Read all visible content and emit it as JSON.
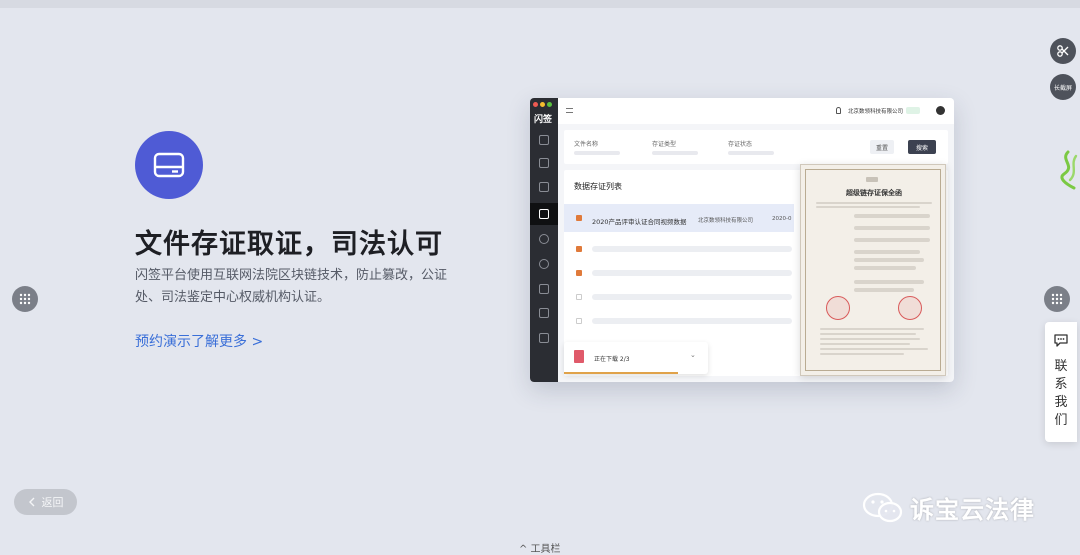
{
  "hero": {
    "title": "文件存证取证，司法认可",
    "description": "闪签平台使用互联网法院区块链技术，防止篡改，公证处、司法鉴定中心权威机构认证。",
    "link": "预约演示了解更多 >"
  },
  "app": {
    "logo": "闪签",
    "company": "北京数领科技有限公司",
    "filter_labels": [
      "文件名称",
      "存证类型",
      "存证状态"
    ],
    "reset_label": "重置",
    "search_label": "搜索",
    "list_title": "数据存证列表",
    "row_title": "2020产品评审认证合同视频数据",
    "row_company": "北京数领科技有限公司",
    "row_date": "2020-0",
    "download_text": "正在下载  2/3"
  },
  "certificate": {
    "title": "超级链存证保全函"
  },
  "widgets": {
    "long_screenshot": "长截屏",
    "contact": "联系我们",
    "back": "返回",
    "toolbar": "^ 工具栏",
    "watermark": "诉宝云法律"
  },
  "colors": {
    "accent": "#4f5bd5",
    "link": "#3a6fd8",
    "checkbox": "#e07a3a"
  }
}
